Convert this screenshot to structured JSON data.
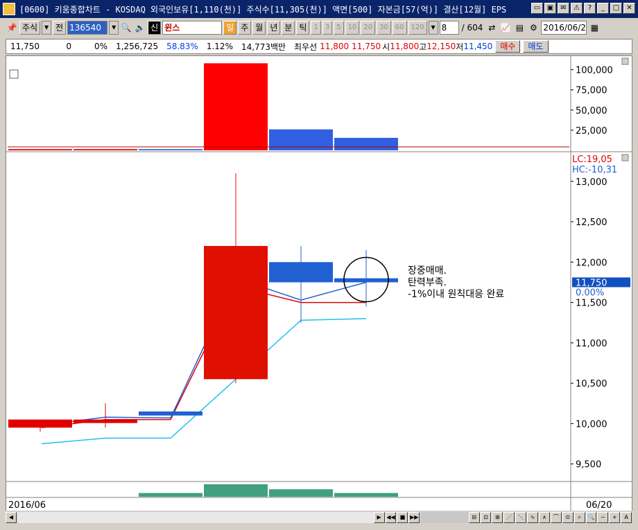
{
  "window": {
    "title": "[0600] 키움종합차트 - KOSDAQ 외국인보유[1,110(천)] 주식수[11,305(천)] 액면[500] 자본금[57(억)] 결산[12월] EPS"
  },
  "toolbar": {
    "market": "주식",
    "prev_label": "전",
    "code": "136540",
    "shin_label": "신",
    "stock_name": "윈스",
    "periods": [
      "일",
      "주",
      "월",
      "년",
      "분",
      "틱"
    ],
    "active_period": "일",
    "minute_steps": [
      "1",
      "3",
      "5",
      "10",
      "20",
      "30",
      "60",
      "120"
    ],
    "count_value": "8",
    "count_total": "/ 604",
    "date": "2016/06/2"
  },
  "quote": {
    "price": "11,750",
    "change": "0",
    "change_pct": "0%",
    "volume": "1,256,725",
    "vol_ratio": "58.83%",
    "turnover": "1.12%",
    "trade_value": "14,773백만",
    "best_quote_label": "최우선",
    "best_ask": "11,800",
    "best_bid": "11,750",
    "open_label": "시",
    "open": "11,800",
    "high_label": "고",
    "high": "12,150",
    "low_label": "저",
    "low": "11,450",
    "buy_label": "매수",
    "sell_label": "매도"
  },
  "chart_data": {
    "type": "candlestick",
    "upper_panel": {
      "title": "",
      "y_ticks": [
        "100,000",
        "75,000",
        "50,000",
        "25,000"
      ],
      "ylim": [
        0,
        110000
      ],
      "bars": [
        {
          "value": 1500,
          "color": "#e00000"
        },
        {
          "value": 1500,
          "color": "#e00000"
        },
        {
          "value": 1500,
          "color": "#3060e0"
        },
        {
          "value": 108000,
          "color": "#ff0000"
        },
        {
          "value": 26000,
          "color": "#3060e0"
        },
        {
          "value": 15500,
          "color": "#3060e0"
        }
      ]
    },
    "main_panel": {
      "lc_label": "LC:19,05",
      "hc_label": "HC:-10,31",
      "y_ticks": [
        "13,000",
        "12,500",
        "12,000",
        "11,500",
        "11,000",
        "10,500",
        "10,000",
        "9,500"
      ],
      "ylim": [
        9300,
        13350
      ],
      "current_price": "11,750",
      "current_pct": "0.00%",
      "candles": [
        {
          "open": 10050,
          "close": 9950,
          "high": 10050,
          "low": 9900,
          "color": "#e00000"
        },
        {
          "open": 10050,
          "close": 10050,
          "high": 10250,
          "low": 9950,
          "color": "#e00000"
        },
        {
          "open": 10150,
          "close": 10100,
          "high": 10150,
          "low": 10100,
          "color": "#2060d0"
        },
        {
          "open": 10550,
          "close": 12200,
          "high": 13100,
          "low": 10500,
          "color": "#e01000"
        },
        {
          "open": 12000,
          "close": 11750,
          "high": 12200,
          "low": 11250,
          "color": "#2060d0"
        },
        {
          "open": 11800,
          "close": 11750,
          "high": 12150,
          "low": 11450,
          "color": "#2060d0"
        }
      ],
      "ma_red": [
        9950,
        10050,
        10050,
        11700,
        11500,
        11500
      ],
      "ma_blue": [
        9980,
        10080,
        10070,
        11800,
        11530,
        11750
      ],
      "ma_cyan": [
        9750,
        9820,
        9820,
        10550,
        11280,
        11300
      ],
      "annotation": [
        "장중매매.",
        "탄력부족.",
        "-1%이내 원칙대응 완료"
      ]
    },
    "volume_panel": {
      "bars": [
        0,
        0,
        0.3,
        1.0,
        0.6,
        0.3
      ]
    },
    "x_labels": {
      "start": "2016/06",
      "end": "06/20"
    }
  }
}
